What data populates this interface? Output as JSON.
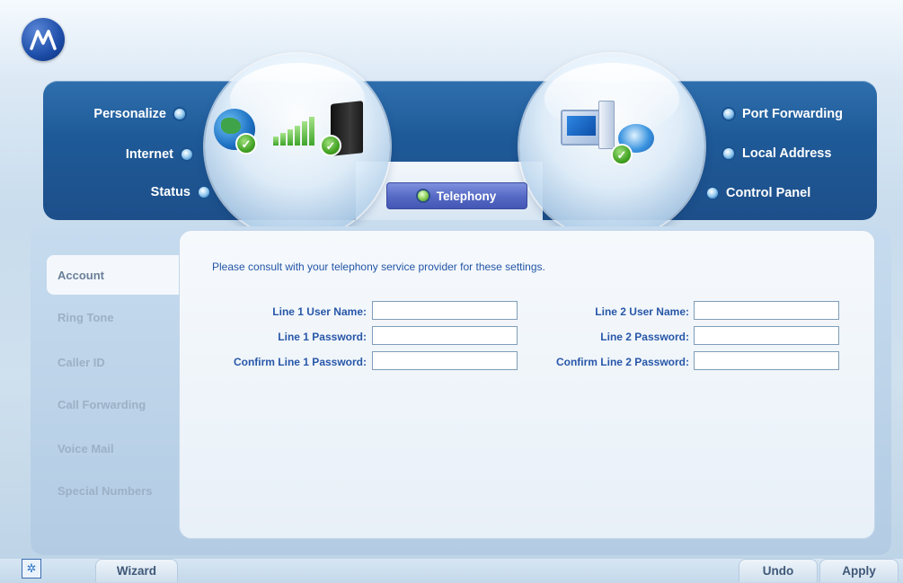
{
  "brand": {
    "logo": "motorola-logo"
  },
  "nav": {
    "left": [
      {
        "label": "Personalize"
      },
      {
        "label": "Internet"
      },
      {
        "label": "Status"
      }
    ],
    "center": {
      "label": "Telephony"
    },
    "right": [
      {
        "label": "Port Forwarding"
      },
      {
        "label": "Local Address"
      },
      {
        "label": "Control Panel"
      }
    ]
  },
  "sidebar": {
    "items": [
      {
        "label": "Account",
        "active": true
      },
      {
        "label": "Ring Tone"
      },
      {
        "label": "Caller ID"
      },
      {
        "label": "Call Forwarding"
      },
      {
        "label": "Voice Mail"
      },
      {
        "label": "Special Numbers"
      }
    ]
  },
  "content": {
    "notice": "Please consult with your telephony service provider for these settings.",
    "fields": {
      "line1_user_label": "Line 1 User Name:",
      "line1_user_value": "",
      "line1_pass_label": "Line 1 Password:",
      "line1_pass_value": "",
      "line1_confirm_label": "Confirm Line 1 Password:",
      "line1_confirm_value": "",
      "line2_user_label": "Line 2 User Name:",
      "line2_user_value": "",
      "line2_pass_label": "Line 2 Password:",
      "line2_pass_value": "",
      "line2_confirm_label": "Confirm Line 2 Password:",
      "line2_confirm_value": ""
    }
  },
  "footer": {
    "wizard_label": "Wizard",
    "undo_label": "Undo",
    "apply_label": "Apply"
  },
  "colors": {
    "accent": "#1e5a98",
    "label_blue": "#2857a8",
    "tab_purple": "#5468c4"
  }
}
